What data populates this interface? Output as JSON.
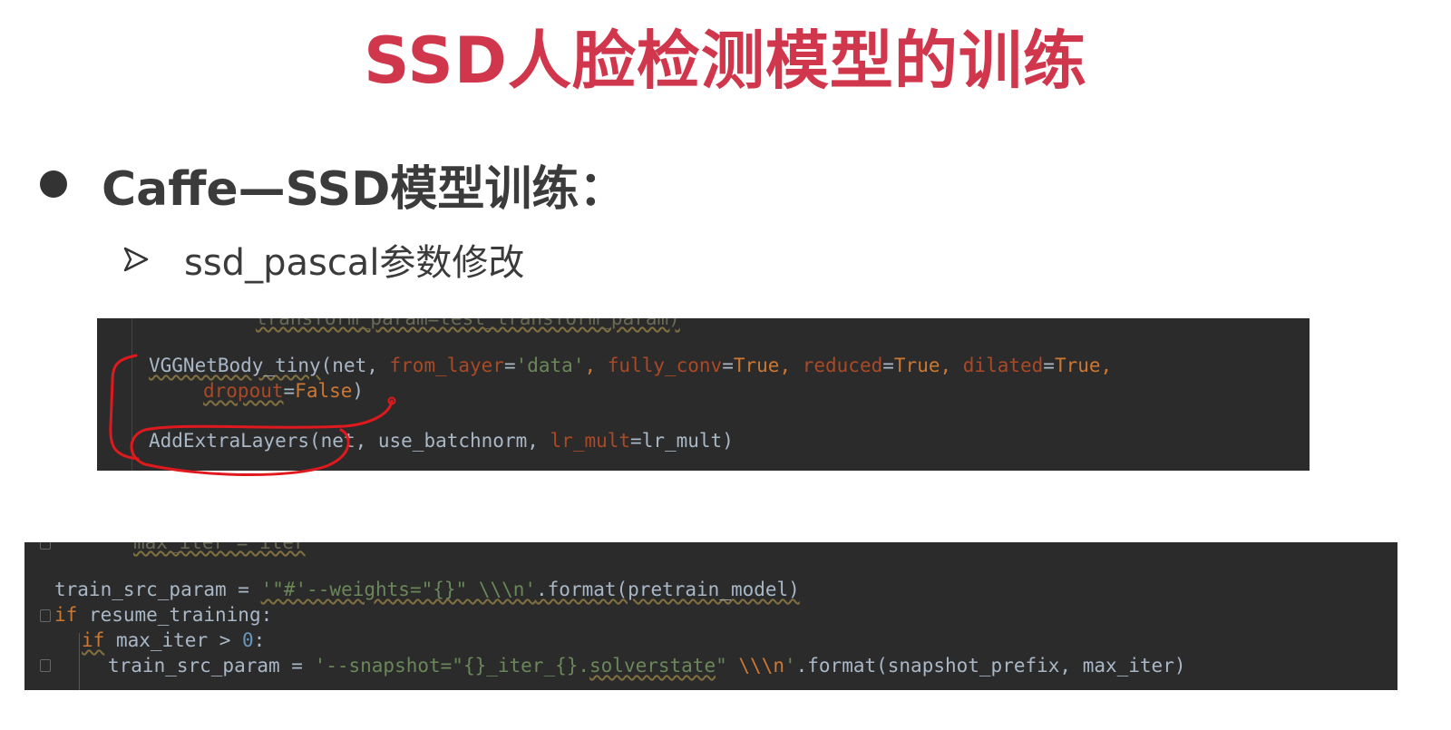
{
  "slide": {
    "title": "SSD人脸检测模型的训练",
    "bullet": "Caffe—SSD模型训练：",
    "sub_bullet": "ssd_pascal参数修改"
  },
  "colors": {
    "title": "#d0374c",
    "code_bg": "#2b2b2b",
    "annotation": "#e0191e"
  },
  "icons": {
    "bullet": "filled-circle-bullet",
    "sub_bullet": "arrowhead-bullet"
  },
  "code_block_1": {
    "partial_top_line": "transform_param=test_transform_param)",
    "tokens": {
      "l1_fn": "VGGNetBody_tiny",
      "l1_a": "(net, ",
      "l1_p1": "from_layer",
      "l1_eq1": "=",
      "l1_s1": "'data'",
      "l1_c1": ", ",
      "l1_p2": "fully_conv",
      "l1_eq2": "=",
      "l1_v2": "True",
      "l1_c2": ", ",
      "l1_p3": "reduced",
      "l1_eq3": "=",
      "l1_v3": "True",
      "l1_c3": ", ",
      "l1_p4": "dilated",
      "l1_eq4": "=",
      "l1_v4": "True",
      "l1_c4": ",",
      "l2_p": "dropout",
      "l2_eq": "=",
      "l2_v": "False",
      "l2_end": ")",
      "l3_fn": "AddExtraLayers",
      "l3_a": "(net, use_batchnorm, ",
      "l3_p": "lr_mult",
      "l3_b": "=lr_mult)"
    }
  },
  "code_block_2": {
    "partial_top_line": "max_iter = iter",
    "tokens": {
      "l1_a": "train_src_param = ",
      "l1_s": "'\"#'--weights=\"{}\" \\\\\\n'",
      "l1_b": ".format(pretrain_model)",
      "l2_kw": "if",
      "l2_a": " resume_training:",
      "l3_kw": "if",
      "l3_a": " max_iter > ",
      "l3_n": "0",
      "l3_b": ":",
      "l4_a": "train_src_param = ",
      "l4_s1": "'--snapshot=\"{}_iter_{}.",
      "l4_s2": "solverstate",
      "l4_s3": "\" ",
      "l4_esc": "\\\\\\n",
      "l4_s4": "'",
      "l4_b": ".format(snapshot_prefix, max_iter)"
    }
  }
}
